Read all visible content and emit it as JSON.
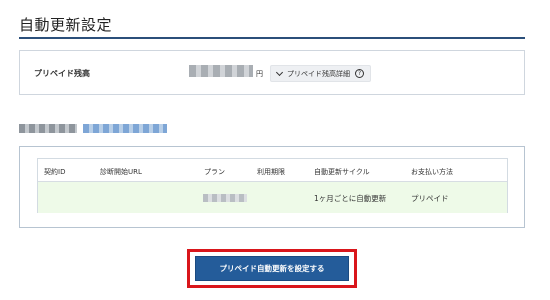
{
  "page": {
    "title": "自動更新設定"
  },
  "balance": {
    "label": "プリペイド残高",
    "amount": "",
    "unit": "円",
    "details_label": "プリペイド残高詳細",
    "help_icon": "?"
  },
  "table": {
    "headers": [
      "契約ID",
      "診断開始URL",
      "プラン",
      "利用期限",
      "自動更新サイクル",
      "お支払い方法"
    ],
    "rows": [
      {
        "contract_id": "",
        "start_url": "",
        "plan": "",
        "expiry": "",
        "cycle": "1ヶ月ごとに自動更新",
        "payment": "プリペイド"
      }
    ]
  },
  "actions": {
    "primary_label": "プリペイド自動更新を設定する"
  },
  "colors": {
    "accent": "#245c9a",
    "highlight": "#d9161b",
    "row_bg": "#eefae8"
  }
}
